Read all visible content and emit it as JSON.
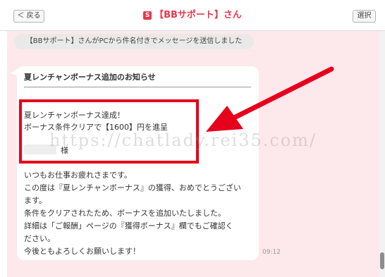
{
  "header": {
    "back_label": "＜ 戻る",
    "title_icon": "S",
    "title": "【BBサポート】さん",
    "select_label": "選択"
  },
  "notice": "【BBサポート】さんがPCから件名付きでメッセージを送信しました",
  "message": {
    "subject": "夏レンチャンボーナス追加のお知らせ",
    "highlight_line1": "夏レンチャンボーナス達成！",
    "highlight_line2": "ボーナス条件クリアで【1600】円を進呈",
    "recipient_suffix": "様",
    "body_lines": [
      "いつもお仕事お疲れさまです。",
      "この度は『夏レンチャンボーナス』の獲得、おめでとうござい",
      "ます。",
      "条件をクリアされたため、ボーナスを追加いたしました。",
      "詳細は「ご報酬」ページの『獲得ボーナス』欄でもご確認く",
      "ださい。",
      "今後ともよろしくお願いします！"
    ],
    "time": "09:12"
  },
  "watermark": "https://chatlady.rei35.com/",
  "colors": {
    "accent": "#e8384f",
    "highlight_border": "#e6001b",
    "chat_bg": "#fde8ec"
  }
}
